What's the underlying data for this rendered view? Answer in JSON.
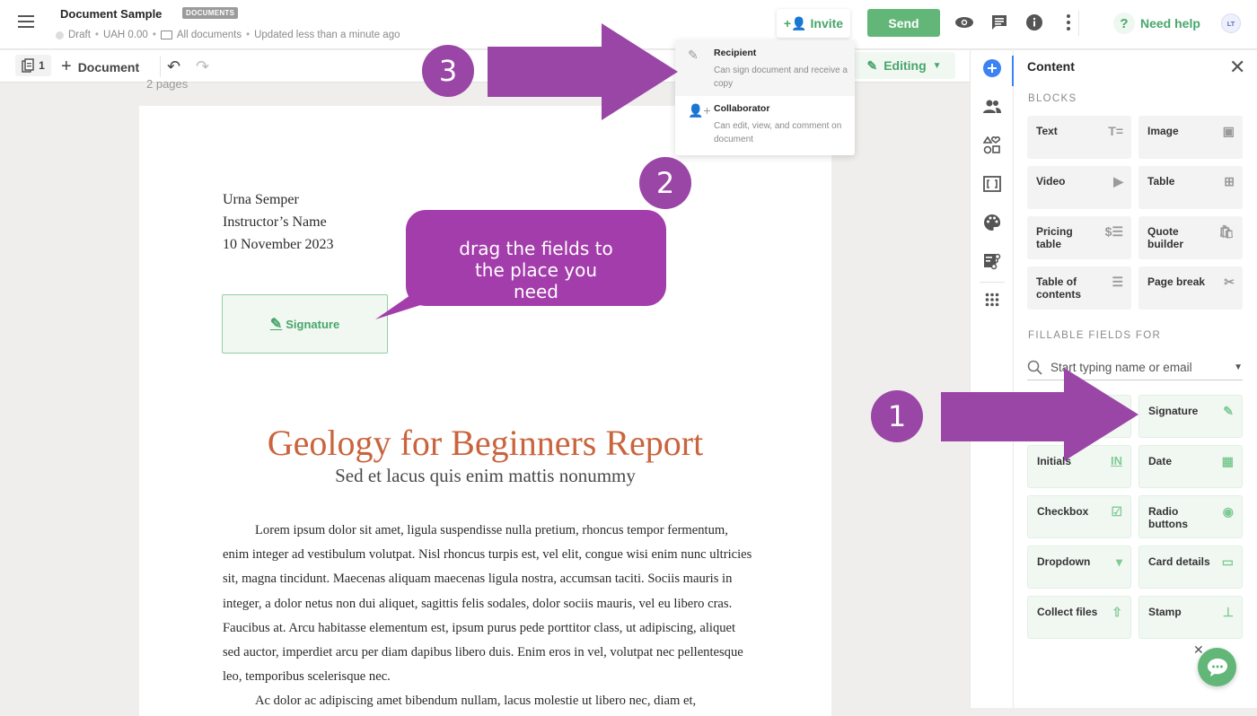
{
  "header": {
    "doc_title": "Document Sample",
    "badge": "DOCUMENTS",
    "status": "Draft",
    "amount": "UAH 0.00",
    "folder": "All documents",
    "updated": "Updated less than a minute ago",
    "invite_label": "Invite",
    "send_label": "Send",
    "help_label": "Need help",
    "avatar_initials": "LT"
  },
  "toolbar": {
    "page_count": "1",
    "add_document_label": "Document",
    "editing_label": "Editing",
    "pages_label": "2 pages"
  },
  "invite_menu": [
    {
      "title": "Recipient",
      "desc": "Can sign document and receive a copy"
    },
    {
      "title": "Collaborator",
      "desc": "Can edit, view, and comment on document"
    }
  ],
  "document": {
    "address_lines": [
      "Urna Semper",
      "Instructor’s Name",
      "10 November 2023"
    ],
    "signature_field_label": "Signature",
    "title": "Geology for Beginners Report",
    "subtitle": "Sed et lacus quis enim mattis nonummy",
    "paragraphs": [
      "Lorem ipsum dolor sit amet, ligula suspendisse nulla pretium, rhoncus tempor fermentum, enim integer ad vestibulum volutpat. Nisl rhoncus turpis est, vel elit, congue wisi enim nunc ultricies sit, magna tincidunt. Maecenas aliquam maecenas ligula nostra, accumsan taciti. Sociis mauris in integer, a dolor netus non dui aliquet, sagittis felis sodales, dolor sociis mauris, vel eu libero cras. Faucibus at. Arcu habitasse elementum est, ipsum purus pede porttitor class, ut adipiscing, aliquet sed auctor, imperdiet arcu per diam dapibus libero duis. Enim eros in vel, volutpat nec pellentesque leo, temporibus scelerisque nec.",
      "Ac dolor ac adipiscing amet bibendum nullam, lacus molestie ut libero nec, diam et,"
    ]
  },
  "panel": {
    "title": "Content",
    "blocks_heading": "BLOCKS",
    "blocks": [
      {
        "label": "Text",
        "icon": "T="
      },
      {
        "label": "Image",
        "icon": "▣"
      },
      {
        "label": "Video",
        "icon": "▶"
      },
      {
        "label": "Table",
        "icon": "⊞"
      },
      {
        "label": "Pricing table",
        "icon": "$☰"
      },
      {
        "label": "Quote builder",
        "icon": "🛍"
      },
      {
        "label": "Table of contents",
        "icon": "☰"
      },
      {
        "label": "Page break",
        "icon": "✂"
      }
    ],
    "fields_heading": "FILLABLE FIELDS FOR",
    "search_placeholder": "Start typing name or email",
    "fields": [
      {
        "label": "",
        "icon": ""
      },
      {
        "label": "Signature",
        "icon": "✎"
      },
      {
        "label": "Initials",
        "icon": "IN"
      },
      {
        "label": "Date",
        "icon": "▦"
      },
      {
        "label": "Checkbox",
        "icon": "☑"
      },
      {
        "label": "Radio buttons",
        "icon": "◉"
      },
      {
        "label": "Dropdown",
        "icon": "▾"
      },
      {
        "label": "Card details",
        "icon": "▭"
      },
      {
        "label": "Collect files",
        "icon": "⇧"
      },
      {
        "label": "Stamp",
        "icon": "⊥"
      }
    ]
  },
  "annotations": {
    "step1": "1",
    "step2": "2",
    "step3": "3",
    "bubble_text": "drag the fields to the place you need"
  },
  "colors": {
    "accent_green": "#62b678",
    "annotation_purple": "#9a46a6",
    "title_orange": "#c9643d"
  }
}
